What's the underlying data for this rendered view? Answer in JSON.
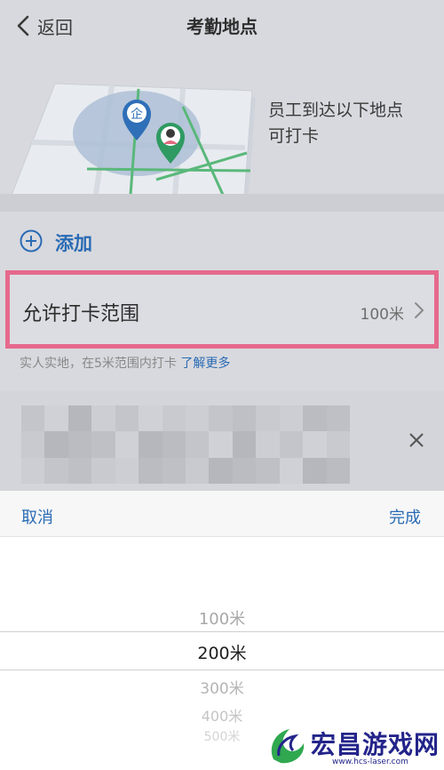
{
  "nav": {
    "back_label": "返回",
    "title": "考勤地点"
  },
  "hero": {
    "line1": "员工到达以下地点",
    "line2": "可打卡",
    "company_pin": "企"
  },
  "add": {
    "label": "添加"
  },
  "range": {
    "label": "允许打卡范围",
    "value": "100米"
  },
  "hint": {
    "text": "实人实地，在5米范围内打卡",
    "link": "了解更多"
  },
  "sheet": {
    "cancel": "取消",
    "done": "完成"
  },
  "picker": {
    "options": [
      "100米",
      "200米",
      "300米",
      "400米",
      "500米"
    ],
    "selected_index": 1
  },
  "watermark": {
    "name": "宏昌游戏网",
    "url": "www.hcs-laser.com"
  },
  "colors": {
    "accent": "#2a6bb4",
    "highlight_border": "#e6698c",
    "overlay": "#d8d9de"
  }
}
